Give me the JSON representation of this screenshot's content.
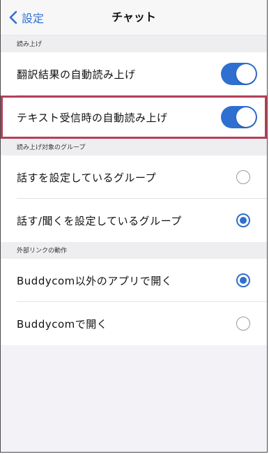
{
  "navbar": {
    "back_label": "設定",
    "title": "チャット"
  },
  "sections": {
    "read_aloud": {
      "header": "読み上げ",
      "items": [
        {
          "label": "翻訳結果の自動読み上げ",
          "toggle": true
        },
        {
          "label": "テキスト受信時の自動読み上げ",
          "toggle": true,
          "highlighted": true
        }
      ]
    },
    "target_group": {
      "header": "読み上げ対象のグループ",
      "items": [
        {
          "label": "話すを設定しているグループ",
          "selected": false
        },
        {
          "label": "話す/聞くを設定しているグループ",
          "selected": true
        }
      ]
    },
    "external_link": {
      "header": "外部リンクの動作",
      "items": [
        {
          "label": "Buddycom以外のアプリで開く",
          "selected": true
        },
        {
          "label": "Buddycomで開く",
          "selected": false
        }
      ]
    }
  },
  "colors": {
    "accent": "#2f6fd0",
    "highlight_border": "#b4405a"
  }
}
